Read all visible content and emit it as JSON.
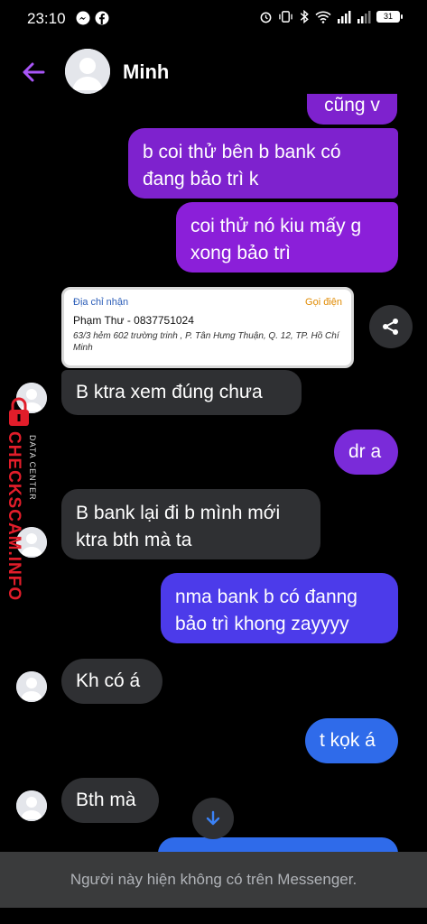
{
  "status_bar": {
    "time": "23:10",
    "battery": "31",
    "left_icons": [
      "messenger-icon",
      "facebook-icon"
    ],
    "right_icons": [
      "alarm-icon",
      "vibrate-icon",
      "bluetooth-icon",
      "wifi-icon",
      "signal-icon",
      "signal-icon",
      "battery-icon"
    ]
  },
  "header": {
    "contact_name": "Minh"
  },
  "messages": [
    {
      "from": "me",
      "text": "cũng v"
    },
    {
      "from": "me",
      "text": "b coi thử bên b bank có đang bảo trì k"
    },
    {
      "from": "me",
      "text": "coi thử nó kiu mấy g xong bảo trì"
    },
    {
      "from": "them",
      "type": "address_card",
      "card": {
        "label": "Địa chỉ nhận",
        "call": "Gọi điện",
        "name": "Phạm Thư - 0837751024",
        "address": "63/3 hẻm 602 trường trinh , P. Tân Hưng Thuận, Q. 12, TP. Hồ Chí Minh"
      }
    },
    {
      "from": "them",
      "text": "B ktra xem đúng chưa"
    },
    {
      "from": "me",
      "text": "dr a"
    },
    {
      "from": "them",
      "text": "B bank lại đi b mình mới ktra bth mà ta"
    },
    {
      "from": "me",
      "text": "nma bank b có đanng bảo trì khong zayyyy"
    },
    {
      "from": "them",
      "text": "Kh có á"
    },
    {
      "from": "me",
      "text": "t kọk á"
    },
    {
      "from": "them",
      "text": "Bth mà"
    }
  ],
  "colors": {
    "bubble_purple": "#7e22ce",
    "bubble_violet": "#8b1fd9",
    "bubble_indigo": "#4c3bea",
    "bubble_blue": "#2f6bea",
    "bubble_grey": "#2f3033",
    "accent": "#a855f7",
    "watermark": "#e11d2a"
  },
  "footer": {
    "notice": "Người này hiện không có trên Messenger."
  },
  "watermark": {
    "brand": "CHECKSCAM.INFO",
    "sub": "DATA CENTER"
  }
}
